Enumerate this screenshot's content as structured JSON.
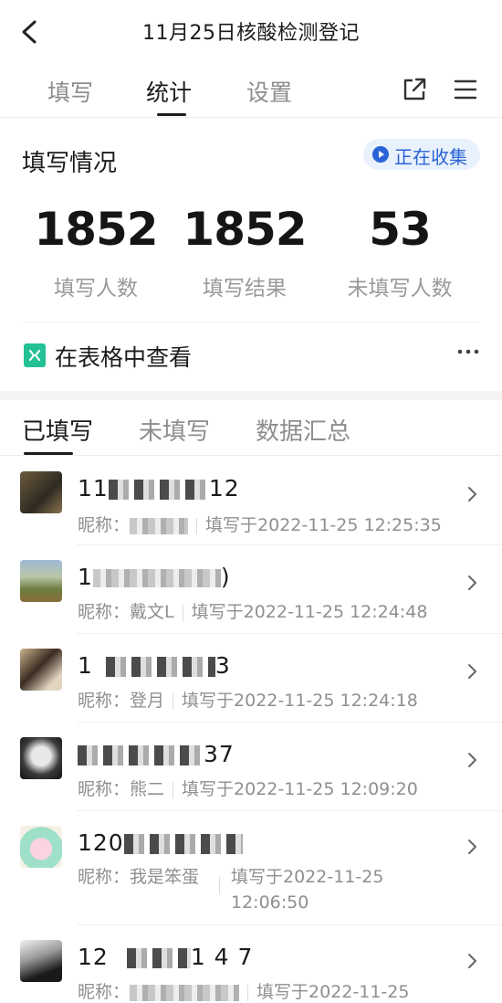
{
  "header": {
    "title": "11月25日核酸检测登记"
  },
  "tabs": [
    {
      "label": "填写"
    },
    {
      "label": "统计"
    },
    {
      "label": "设置"
    }
  ],
  "active_tab": "统计",
  "summary": {
    "title": "填写情况",
    "status": "正在收集",
    "stats": [
      {
        "value": "1852",
        "label": "填写人数"
      },
      {
        "value": "1852",
        "label": "填写结果"
      },
      {
        "value": "53",
        "label": "未填写人数"
      }
    ]
  },
  "sheet_link": {
    "label": "在表格中查看",
    "more": "···"
  },
  "subtabs": [
    {
      "label": "已填写"
    },
    {
      "label": "未填写"
    },
    {
      "label": "数据汇总"
    }
  ],
  "records": [
    {
      "name": "11",
      "name_tail": "12",
      "nick_label": "昵称：",
      "nickname": "",
      "submitted": "填写于2022-11-25 12:25:35"
    },
    {
      "name": "1",
      "name_tail": ")",
      "nick_label": "昵称：",
      "nickname": "戴文L",
      "submitted": "填写于2022-11-25 12:24:48"
    },
    {
      "name": "1",
      "name_tail": "3",
      "nick_label": "昵称：",
      "nickname": "登月",
      "submitted": "填写于2022-11-25 12:24:18"
    },
    {
      "name": "",
      "name_tail": "37",
      "nick_label": "昵称：",
      "nickname": "熊二",
      "submitted": "填写于2022-11-25 12:09:20"
    },
    {
      "name": "120",
      "name_tail": "",
      "nick_label": "昵称：",
      "nickname": "我是笨蛋",
      "submitted": "填写于2022-11-25 12:06:50"
    },
    {
      "name": "12",
      "name_tail": "1 4 7",
      "nick_label": "昵称：",
      "nickname": "",
      "submitted": "填写于2022-11-25"
    }
  ]
}
